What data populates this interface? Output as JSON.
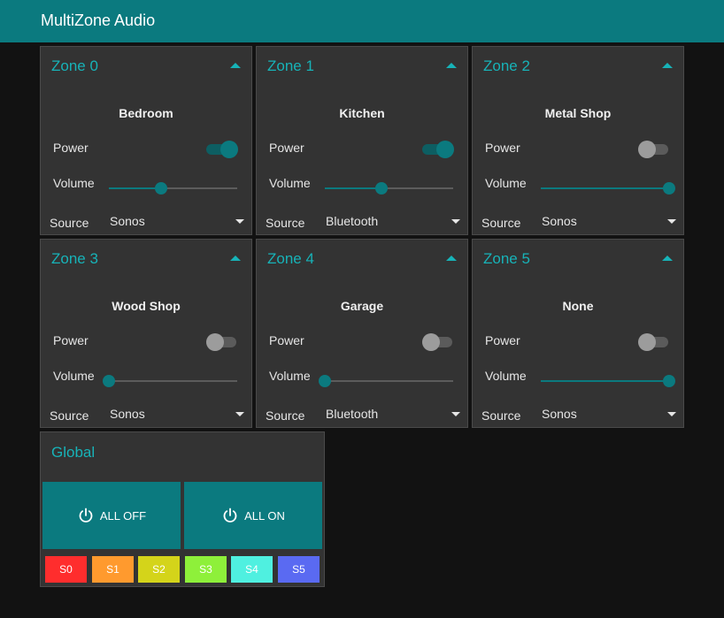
{
  "app": {
    "title": "MultiZone Audio"
  },
  "labels": {
    "power": "Power",
    "volume": "Volume",
    "source": "Source"
  },
  "zones": [
    {
      "title": "Zone 0",
      "name": "Bedroom",
      "power": true,
      "volume": 0.41,
      "source": "Sonos"
    },
    {
      "title": "Zone 1",
      "name": "Kitchen",
      "power": true,
      "volume": 0.44,
      "source": "Bluetooth"
    },
    {
      "title": "Zone 2",
      "name": "Metal Shop",
      "power": false,
      "volume": 1.0,
      "source": "Sonos"
    },
    {
      "title": "Zone 3",
      "name": "Wood Shop",
      "power": false,
      "volume": 0.0,
      "source": "Sonos"
    },
    {
      "title": "Zone 4",
      "name": "Garage",
      "power": false,
      "volume": 0.0,
      "source": "Bluetooth"
    },
    {
      "title": "Zone 5",
      "name": "None",
      "power": false,
      "volume": 1.0,
      "source": "Sonos"
    }
  ],
  "global": {
    "title": "Global",
    "all_off_label": "ALL OFF",
    "all_on_label": "ALL ON",
    "power_icon": "power-icon",
    "sources": [
      {
        "label": "S0",
        "color": "#ff2d2d",
        "text_color": "#ffffff"
      },
      {
        "label": "S1",
        "color": "#ff9a2e",
        "text_color": "#ffffff"
      },
      {
        "label": "S2",
        "color": "#d4d41a",
        "text_color": "#ffffff"
      },
      {
        "label": "S3",
        "color": "#8ef03a",
        "text_color": "#ffffff"
      },
      {
        "label": "S4",
        "color": "#4ff0e0",
        "text_color": "#ffffff"
      },
      {
        "label": "S5",
        "color": "#5a6af2",
        "text_color": "#ffffff"
      }
    ]
  },
  "colors": {
    "accent": "#0b7a7f",
    "accent_text": "#17b3b8",
    "panel": "#333333",
    "background": "#121212"
  }
}
